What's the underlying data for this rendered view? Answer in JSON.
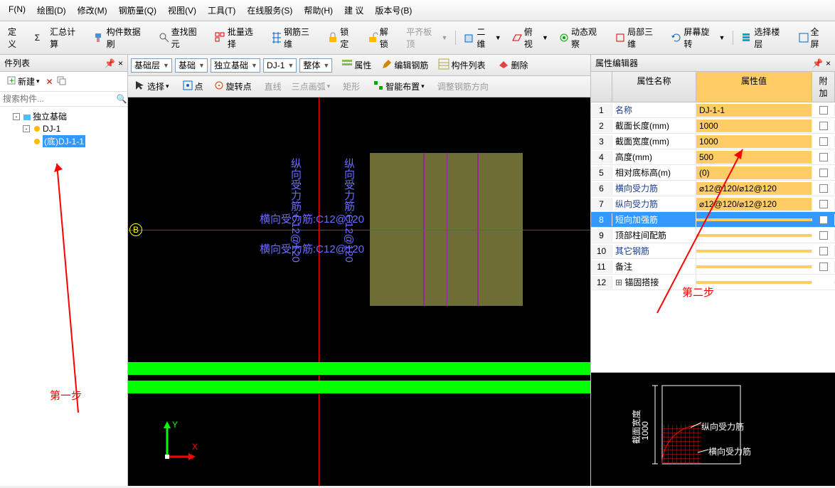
{
  "menubar": [
    "F(N)",
    "绘图(D)",
    "修改(M)",
    "钢筋量(Q)",
    "视图(V)",
    "工具(T)",
    "在线服务(S)",
    "帮助(H)",
    "建 议",
    "版本号(B)"
  ],
  "toolbar1": {
    "define": "定义",
    "sigma": "Σ",
    "summary": "汇总计算",
    "brush": "构件数据刷",
    "find": "查找图元",
    "batch": "批量选择",
    "rebar3d": "钢筋三维",
    "lock": "锁定",
    "unlock": "解锁",
    "align": "平齐板顶",
    "dim2d": "二维",
    "persp": "俯视",
    "dynview": "动态观察",
    "local3d": "局部三维",
    "screenrot": "屏幕旋转",
    "selfloor": "选择楼层",
    "fullscreen": "全屏"
  },
  "left": {
    "title": "件列表",
    "new": "新建",
    "search_ph": "搜索构件...",
    "root": "独立基础",
    "node1": "DJ-1",
    "node2": "(底)DJ-1-1"
  },
  "sub1": {
    "layer": "基础层",
    "cat": "基础",
    "type": "独立基础",
    "comp": "DJ-1",
    "mode": "整体"
  },
  "sub2": {
    "attr": "属性",
    "editrebar": "编辑钢筋",
    "complist": "构件列表",
    "delete": "删除"
  },
  "bar3": {
    "select": "选择",
    "point": "点",
    "rotpoint": "旋转点",
    "line": "直线",
    "arc": "三点画弧",
    "rect": "矩形",
    "smart": "智能布置",
    "adjdir": "调整钢筋方向"
  },
  "canvas": {
    "h_label": "横向受力筋:C12@120",
    "v_label": "纵向受力筋:C12@120",
    "axis_b": "B",
    "axis_y": "Y",
    "axis_x": "X"
  },
  "right": {
    "title": "属性编辑器",
    "col_name": "属性名称",
    "col_val": "属性值",
    "col_ext": "附加",
    "rows": [
      {
        "i": "1",
        "name": "名称",
        "val": "DJ-1-1",
        "blue": true
      },
      {
        "i": "2",
        "name": "截面长度(mm)",
        "val": "1000"
      },
      {
        "i": "3",
        "name": "截面宽度(mm)",
        "val": "1000"
      },
      {
        "i": "4",
        "name": "高度(mm)",
        "val": "500"
      },
      {
        "i": "5",
        "name": "相对底标高(m)",
        "val": "(0)"
      },
      {
        "i": "6",
        "name": "横向受力筋",
        "val": "⌀12@120/⌀12@120",
        "blue": true
      },
      {
        "i": "7",
        "name": "纵向受力筋",
        "val": "⌀12@120/⌀12@120",
        "blue": true
      },
      {
        "i": "8",
        "name": "短向加强筋",
        "val": "",
        "blue": true,
        "sel": true
      },
      {
        "i": "9",
        "name": "顶部柱间配筋",
        "val": ""
      },
      {
        "i": "10",
        "name": "其它钢筋",
        "val": "",
        "blue": true
      },
      {
        "i": "11",
        "name": "备注",
        "val": ""
      },
      {
        "i": "12",
        "name": "锚固搭接",
        "val": "",
        "expand": true
      }
    ]
  },
  "preview": {
    "dim": "1000",
    "dimlabel": "截面宽度",
    "v": "纵向受力筋",
    "h": "横向受力筋"
  },
  "steps": {
    "s1": "第一步",
    "s2": "第二步"
  }
}
